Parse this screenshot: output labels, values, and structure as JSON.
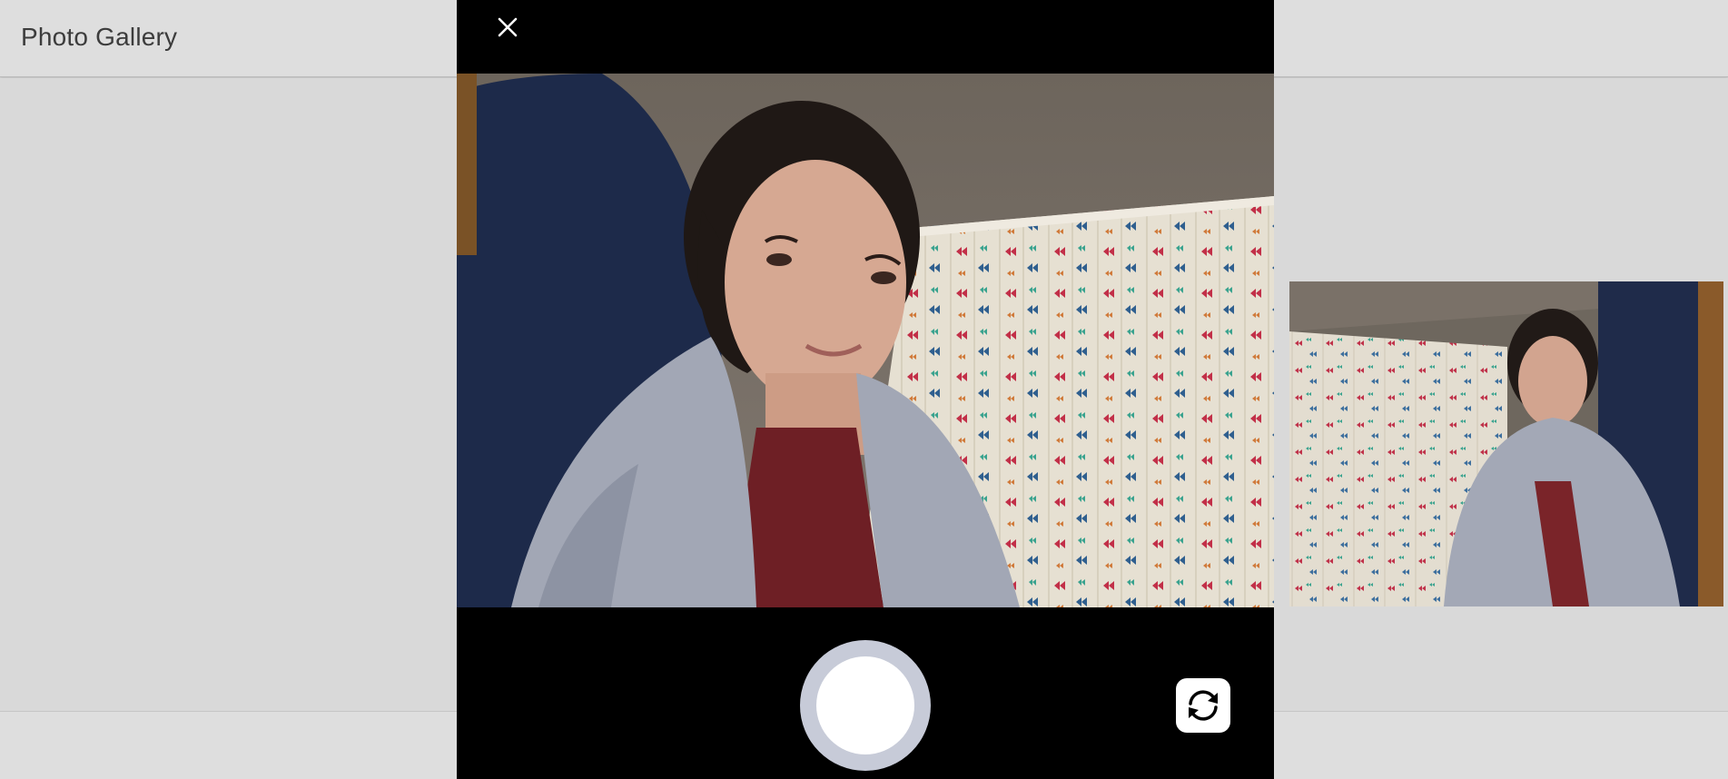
{
  "app": {
    "title": "Photo Gallery"
  },
  "camera": {
    "close_icon": "close-icon",
    "shutter_icon": "shutter-button",
    "flip_icon": "switch-camera-icon"
  },
  "colors": {
    "modal_background": "#000000",
    "shutter_ring": "#c7cbd8",
    "page_background": "#d9d9d9"
  }
}
